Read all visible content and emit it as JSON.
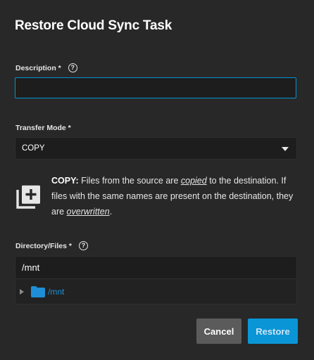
{
  "dialog": {
    "title": "Restore Cloud Sync Task"
  },
  "description": {
    "label": "Description *",
    "value": "",
    "placeholder": ""
  },
  "transfer_mode": {
    "label": "Transfer Mode *",
    "selected": "COPY"
  },
  "info": {
    "strong": "COPY:",
    "part1": " Files from the source are ",
    "em1": "copied",
    "part2": " to the destination. If files with the same names are present on the destination, they are ",
    "em2": "overwritten",
    "part3": "."
  },
  "directory": {
    "label": "Directory/Files *",
    "value": "/mnt",
    "tree_items": [
      {
        "label": "/mnt",
        "icon": "folder-icon"
      }
    ]
  },
  "actions": {
    "cancel": "Cancel",
    "restore": "Restore"
  },
  "colors": {
    "background": "#282828",
    "accent": "#0a95d6",
    "folder": "#1e8fd6"
  }
}
